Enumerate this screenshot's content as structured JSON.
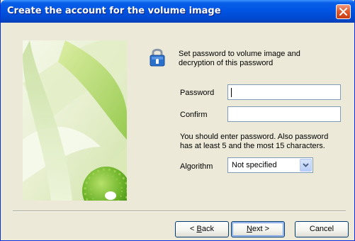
{
  "window": {
    "title": "Create the account for the volume image"
  },
  "intro": {
    "text": "Set password to volume image and decryption of this password"
  },
  "fields": {
    "password": {
      "label": "Password",
      "value": ""
    },
    "confirm": {
      "label": "Confirm",
      "value": ""
    }
  },
  "hint": {
    "text": "You should enter password. Also password has at least 5 and the most 15 characters."
  },
  "algorithm": {
    "label": "Algorithm",
    "selected": "Not specified"
  },
  "buttons": {
    "back": {
      "mnemonic": "B",
      "rest": "ack",
      "prefix": "< "
    },
    "next": {
      "mnemonic": "N",
      "rest": "ext",
      "suffix": " >"
    },
    "cancel": {
      "label": "Cancel"
    }
  },
  "icons": {
    "lock": "lock-icon",
    "close": "close-icon",
    "dropdown": "chevron-down-icon"
  },
  "colors": {
    "titlebar": "#0054e3",
    "window_bg": "#ece9d8",
    "close_button": "#e05a2f",
    "field_border": "#7f9db9"
  }
}
